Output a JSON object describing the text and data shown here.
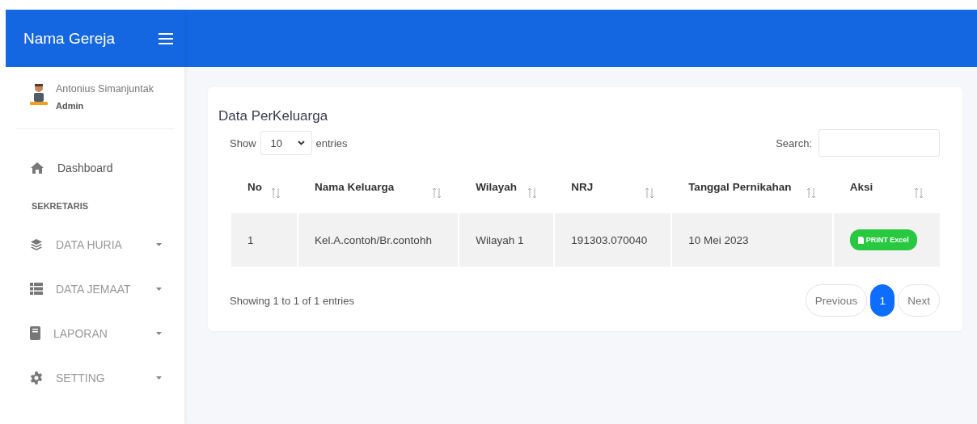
{
  "brand": "Nama Gereja",
  "user": {
    "name": "Antonius Simanjuntak",
    "role": "Admin"
  },
  "nav": [
    {
      "kind": "link",
      "label": "Dashboard"
    },
    {
      "kind": "section",
      "label": "SEKRETARIS"
    },
    {
      "kind": "menu",
      "label": "DATA HURIA"
    },
    {
      "kind": "menu",
      "label": "DATA JEMAAT"
    },
    {
      "kind": "menu",
      "label": "LAPORAN"
    },
    {
      "kind": "menu",
      "label": "SETTING"
    }
  ],
  "card": {
    "title": "Data PerKeluarga",
    "show_label": "Show",
    "page_size": "10",
    "entries_label": "entries",
    "search_label": "Search:"
  },
  "table": {
    "columns": [
      "No",
      "Nama Keluarga",
      "Wilayah",
      "NRJ",
      "Tanggal Pernikahan",
      "Aksi"
    ],
    "rows": [
      {
        "cells": [
          "1",
          "Kel.A.contoh/Br.contohh",
          "Wilayah 1",
          "191303.070040",
          "10 Mei 2023"
        ],
        "action": "PRINT Excel"
      }
    ]
  },
  "info": "Showing 1 to 1 of 1 entries",
  "pagination": [
    {
      "label": "Previous",
      "selected": false
    },
    {
      "label": "1",
      "selected": true
    },
    {
      "label": "Next",
      "selected": false
    }
  ]
}
